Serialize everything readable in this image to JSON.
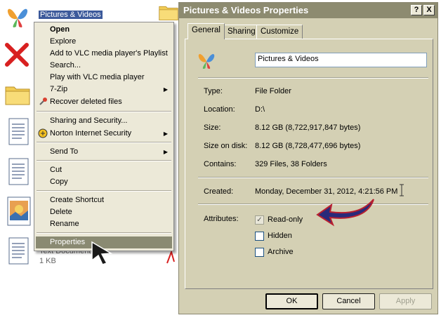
{
  "desktop": {
    "selected_file": "Pictures & Videos",
    "partial_file_type": "Text Document",
    "partial_file_size": "1 KB"
  },
  "context_menu": {
    "items": [
      {
        "label": "Open",
        "bold": true
      },
      {
        "label": "Explore"
      },
      {
        "label": "Add to VLC media player's Playlist"
      },
      {
        "label": "Search..."
      },
      {
        "label": "Play with VLC media player"
      },
      {
        "label": "7-Zip",
        "submenu": true
      },
      {
        "label": "Recover deleted files",
        "icon": "recover-icon"
      },
      {
        "label": "Sharing and Security..."
      },
      {
        "label": "Norton Internet Security",
        "icon": "norton-icon",
        "submenu": true
      },
      {
        "label": "Send To",
        "submenu": true
      },
      {
        "label": "Cut"
      },
      {
        "label": "Copy"
      },
      {
        "label": "Create Shortcut"
      },
      {
        "label": "Delete"
      },
      {
        "label": "Rename"
      },
      {
        "label": "Properties",
        "highlighted": true
      }
    ],
    "submenu_arrow": "▶"
  },
  "dialog": {
    "title": "Pictures & Videos Properties",
    "help_button": "?",
    "close_button": "X",
    "tabs": [
      "General",
      "Sharing",
      "Customize"
    ],
    "active_tab": "General",
    "name_value": "Pictures & Videos",
    "properties": {
      "type_label": "Type:",
      "type_value": "File Folder",
      "location_label": "Location:",
      "location_value": "D:\\",
      "size_label": "Size:",
      "size_value": "8.12 GB (8,722,917,847 bytes)",
      "size_on_disk_label": "Size on disk:",
      "size_on_disk_value": "8.12 GB (8,728,477,696 bytes)",
      "contains_label": "Contains:",
      "contains_value": "329 Files, 38 Folders",
      "created_label": "Created:",
      "created_value": "Monday, December 31, 2012, 4:21:56 PM",
      "attributes_label": "Attributes:"
    },
    "attributes": [
      {
        "label": "Read-only",
        "checked": true,
        "disabled": true
      },
      {
        "label": "Hidden",
        "checked": false
      },
      {
        "label": "Archive",
        "checked": false
      }
    ],
    "buttons": {
      "ok": "OK",
      "cancel": "Cancel",
      "apply": "Apply"
    },
    "check_mark": "✓"
  },
  "colors": {
    "titlebar": "#8d8b70",
    "menu_highlight": "#8a8a72",
    "dialog_bg": "#d4d0b4",
    "selection": "#3c5a9b"
  }
}
